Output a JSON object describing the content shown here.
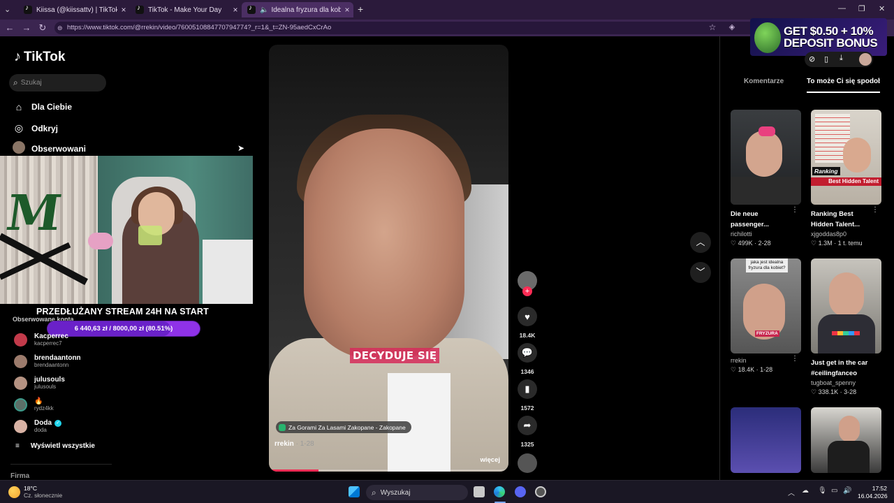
{
  "browser": {
    "tabs": [
      {
        "title": "Kiissa (@kiissattv) | TikTok"
      },
      {
        "title": "TikTok - Make Your Day"
      },
      {
        "title": "Idealna fryzura dla kobiet: po"
      }
    ],
    "url": "https://www.tiktok.com/@rrekin/video/7600510884770794774?_r=1&_t=ZN-95aedCxCrAo"
  },
  "ad": {
    "line1": "GET $0.50 + 10%",
    "line2": "DEPOSIT BONUS"
  },
  "tiktok": {
    "logo": "TikTok",
    "search_placeholder": "Szukaj",
    "nav": [
      {
        "label": "Dla Ciebie"
      },
      {
        "label": "Odkryj"
      },
      {
        "label": "Obserwowani"
      }
    ],
    "followed_heading": "Obserwowane konta",
    "accounts": [
      {
        "name": "Kacperrec",
        "handle": "kacperrec7"
      },
      {
        "name": "brendaantonn",
        "handle": "brendaantonn"
      },
      {
        "name": "julusouls",
        "handle": "julusouls"
      },
      {
        "name": "🔥",
        "handle": "rydz4kk"
      },
      {
        "name": "Doda",
        "handle": "doda"
      }
    ],
    "see_all": "Wyświetl wszystkie",
    "company": "Firma"
  },
  "stream_overlay": {
    "title": "PRZEDŁUŻANY STREAM 24H NA START",
    "goal_text": "6 440,63 zł  /  8000,00 zł (80.51%)",
    "goal_fraction": 0.8051
  },
  "video": {
    "caption": "DECYDUJE SIĘ",
    "location": "Za Gorami Za Lasami Zakopane - Zakopane",
    "author": "rrekin",
    "date": "1-28",
    "more": "więcej",
    "progress_fraction": 0.2
  },
  "actions": {
    "likes": "18.4K",
    "comments": "1346",
    "saves": "1572",
    "shares": "1325"
  },
  "right_panel": {
    "tabs": [
      {
        "label": "Komentarze"
      },
      {
        "label": "To może Ci się spodobać"
      }
    ],
    "cards": [
      {
        "title": "Die neue passenger...",
        "user": "richilotti",
        "likes": "499K",
        "date": "2-28"
      },
      {
        "title": "Ranking Best Hidden Talent...",
        "user": "xjgoddas8p0",
        "likes": "1.3M",
        "date": "1 t. temu",
        "thumb_tag": "Ranking",
        "thumb_banner": "Best Hidden Talent"
      },
      {
        "title": "",
        "user": "rrekin",
        "likes": "18.4K",
        "date": "1-28",
        "thumb_text": "jaka jest idealna fryzura dla kobiet?",
        "thumb_tag": "FRYZURA"
      },
      {
        "title": "Just get in the car #ceilingfanceo",
        "user": "tugboat_spenny",
        "likes": "338.1K",
        "date": "3-28"
      }
    ]
  },
  "taskbar": {
    "weather_temp": "18°C",
    "weather_desc": "Cz. słonecznie",
    "search": "Wyszukaj",
    "time": "17:52",
    "date": "16.04.2026"
  },
  "colors": {
    "accent": "#fe2c55",
    "goal": "#8f32e8",
    "browser": "#2b1a3b"
  }
}
